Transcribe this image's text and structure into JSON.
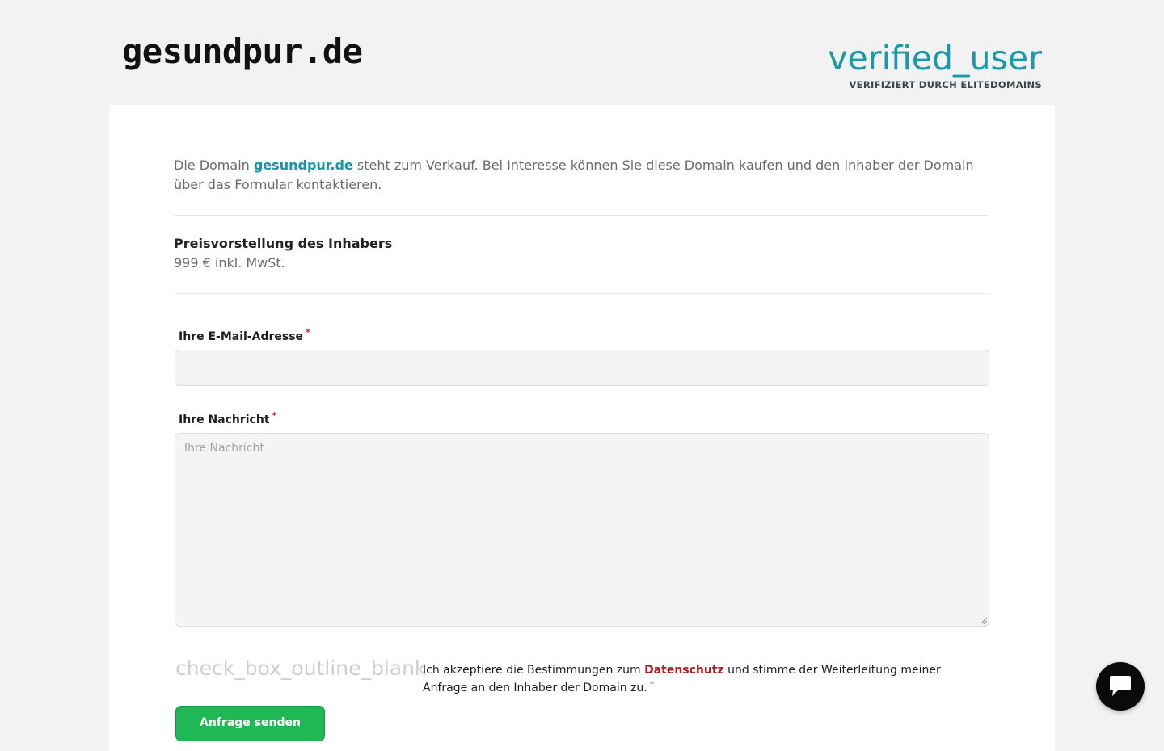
{
  "header": {
    "logo": "gesundpur.de",
    "verified_icon": "verified_user",
    "verified_label": "VERIFIZIERT DURCH ELITEDOMAINS"
  },
  "intro": {
    "prefix": "Die Domain ",
    "domain": "gesundpur.de",
    "suffix": " steht zum Verkauf. Bei Interesse können Sie diese Domain kaufen und den Inhaber der Domain über das Formular kontaktieren."
  },
  "price": {
    "title": "Preisvorstellung des Inhabers",
    "value": "999 € inkl. MwSt."
  },
  "form": {
    "email_label": "Ihre E-Mail-Adresse",
    "email_value": "",
    "message_label": "Ihre Nachricht",
    "message_placeholder": "Ihre Nachricht",
    "required_mark": "*",
    "checkbox_icon": "check_box_outline_blank",
    "consent_prefix": "Ich akzeptiere die Bestimmungen zum ",
    "consent_link": "Datenschutz",
    "consent_suffix": " und stimme der Weiterleitung meiner Anfrage an den Inhaber der Domain zu.",
    "submit_label": "Anfrage senden"
  },
  "chat": {
    "icon": "chat-bubble-icon"
  },
  "colors": {
    "background": "#f2f2f2",
    "accent": "#1795a5",
    "link_red": "#a5201f",
    "button_green": "#1eb954",
    "chat_bg": "#0a0a0a"
  }
}
